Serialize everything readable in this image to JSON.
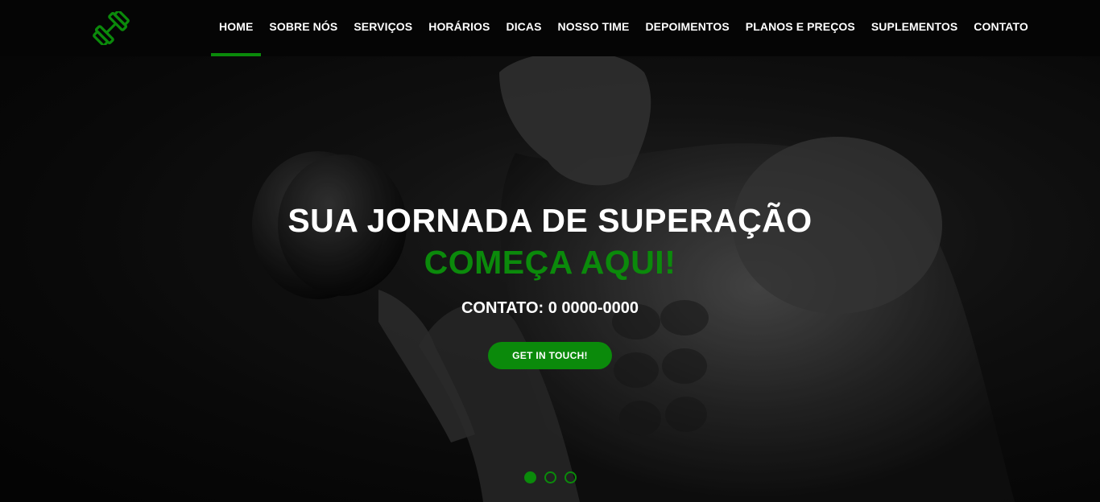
{
  "brand": {
    "logo": "dumbbell-icon",
    "accent_color": "#0b8a0b"
  },
  "nav": {
    "items": [
      {
        "label": "HOME",
        "active": true
      },
      {
        "label": "SOBRE NÓS"
      },
      {
        "label": "SERVIÇOS"
      },
      {
        "label": "HORÁRIOS"
      },
      {
        "label": "DICAS"
      },
      {
        "label": "NOSSO TIME"
      },
      {
        "label": "DEPOIMENTOS"
      },
      {
        "label": "PLANOS E PREÇOS"
      },
      {
        "label": "SUPLEMENTOS"
      },
      {
        "label": "CONTATO"
      }
    ]
  },
  "hero": {
    "headline_1": "SUA JORNADA DE SUPERAÇÃO",
    "headline_2": "COMEÇA AQUI!",
    "contact": "CONTATO: 0 0000-0000",
    "cta_label": "GET IN TOUCH!",
    "slides": {
      "count": 3,
      "active": 1
    }
  }
}
